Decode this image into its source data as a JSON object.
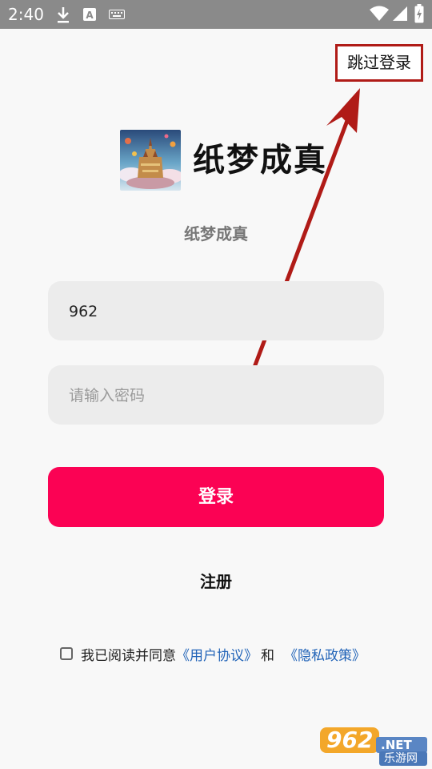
{
  "status_bar": {
    "time": "2:40",
    "icons": [
      "download-icon",
      "a-font-icon",
      "keyboard-icon",
      "wifi-icon",
      "signal-icon",
      "battery-charging-icon"
    ]
  },
  "skip_login": "跳过登录",
  "app": {
    "title": "纸梦成真",
    "subtitle": "纸梦成真",
    "logo": "castle-illustration"
  },
  "form": {
    "username_value": "962",
    "password_placeholder": "请输入密码",
    "login_label": "登录",
    "register_label": "注册"
  },
  "agreement": {
    "prefix": "我已阅读并同意",
    "user_agreement": "《用户协议》",
    "conjunction": "和",
    "privacy_policy": "《隐私政策》",
    "checked": false
  },
  "watermark": {
    "number": "962",
    "suffix": ".NET",
    "text": "乐游网"
  },
  "colors": {
    "accent": "#fb0254",
    "link": "#2264b8",
    "annotation": "#b01b17",
    "status_bar": "#8a8a8a"
  }
}
